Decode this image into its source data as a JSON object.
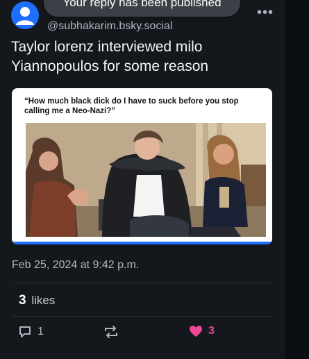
{
  "toast": {
    "message": "Your reply has been published"
  },
  "post": {
    "handle": "@subhakarim.bsky.social",
    "text": "Taylor lorenz interviewed milo Yiannopoulos for some reason",
    "embed": {
      "quote": "“How much black dick do I have to suck before you stop calling me a Neo-Nazi?”"
    },
    "timestamp": "Feb 25, 2024 at 9:42 p.m.",
    "likes": {
      "count": "3",
      "label": "likes"
    },
    "actions": {
      "reply_count": "1",
      "like_count": "3"
    }
  },
  "icons": {
    "avatar": "default-avatar-icon",
    "more": "more-options-icon",
    "reply": "reply-icon",
    "repost": "repost-icon",
    "like": "heart-icon"
  },
  "colors": {
    "accent": "#1f6fff",
    "like": "#ec4899",
    "background": "#14181d"
  }
}
